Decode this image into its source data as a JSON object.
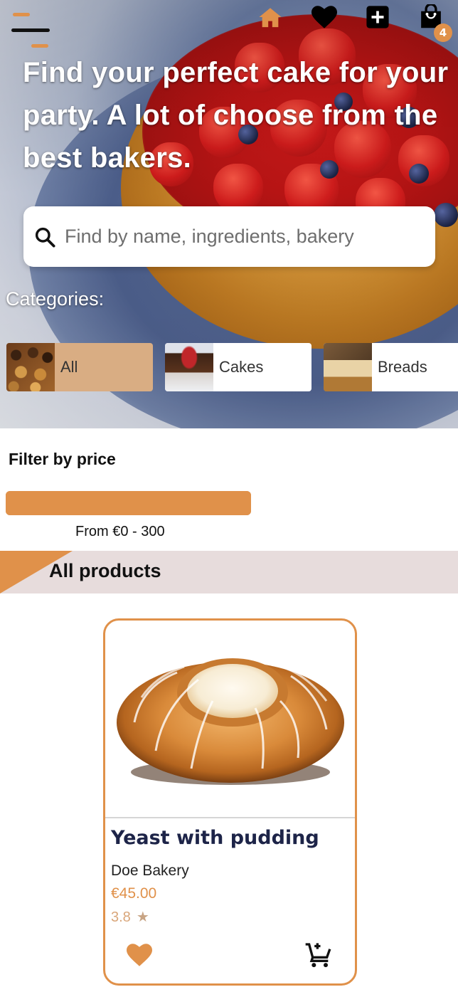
{
  "header": {
    "headline": "Find your perfect cake for your party. A lot of choose from the best bakers.",
    "cart_count": "4",
    "icons": [
      "menu-icon",
      "home-icon",
      "heart-icon",
      "add-icon",
      "shopping-bag-icon"
    ]
  },
  "search": {
    "placeholder": "Find by name, ingredients, bakery",
    "value": ""
  },
  "categories": {
    "label": "Categories:",
    "items": [
      {
        "name": "All",
        "active": true
      },
      {
        "name": "Cakes",
        "active": false
      },
      {
        "name": "Breads",
        "active": false
      }
    ]
  },
  "filter": {
    "title": "Filter by price",
    "range_text": "From €0 - 300",
    "min": 0,
    "max": 300,
    "fill_percent": 100
  },
  "section": {
    "title": "All products"
  },
  "products": [
    {
      "name": "Yeast with pudding",
      "bakery": "Doe Bakery",
      "price": "€45.00",
      "rating": "3.8",
      "rating_icon": "★"
    }
  ],
  "colors": {
    "accent": "#e0914a",
    "active_chip": "#d9ad83",
    "title_text": "#1d2448",
    "section_bg": "#e7dcdc"
  }
}
